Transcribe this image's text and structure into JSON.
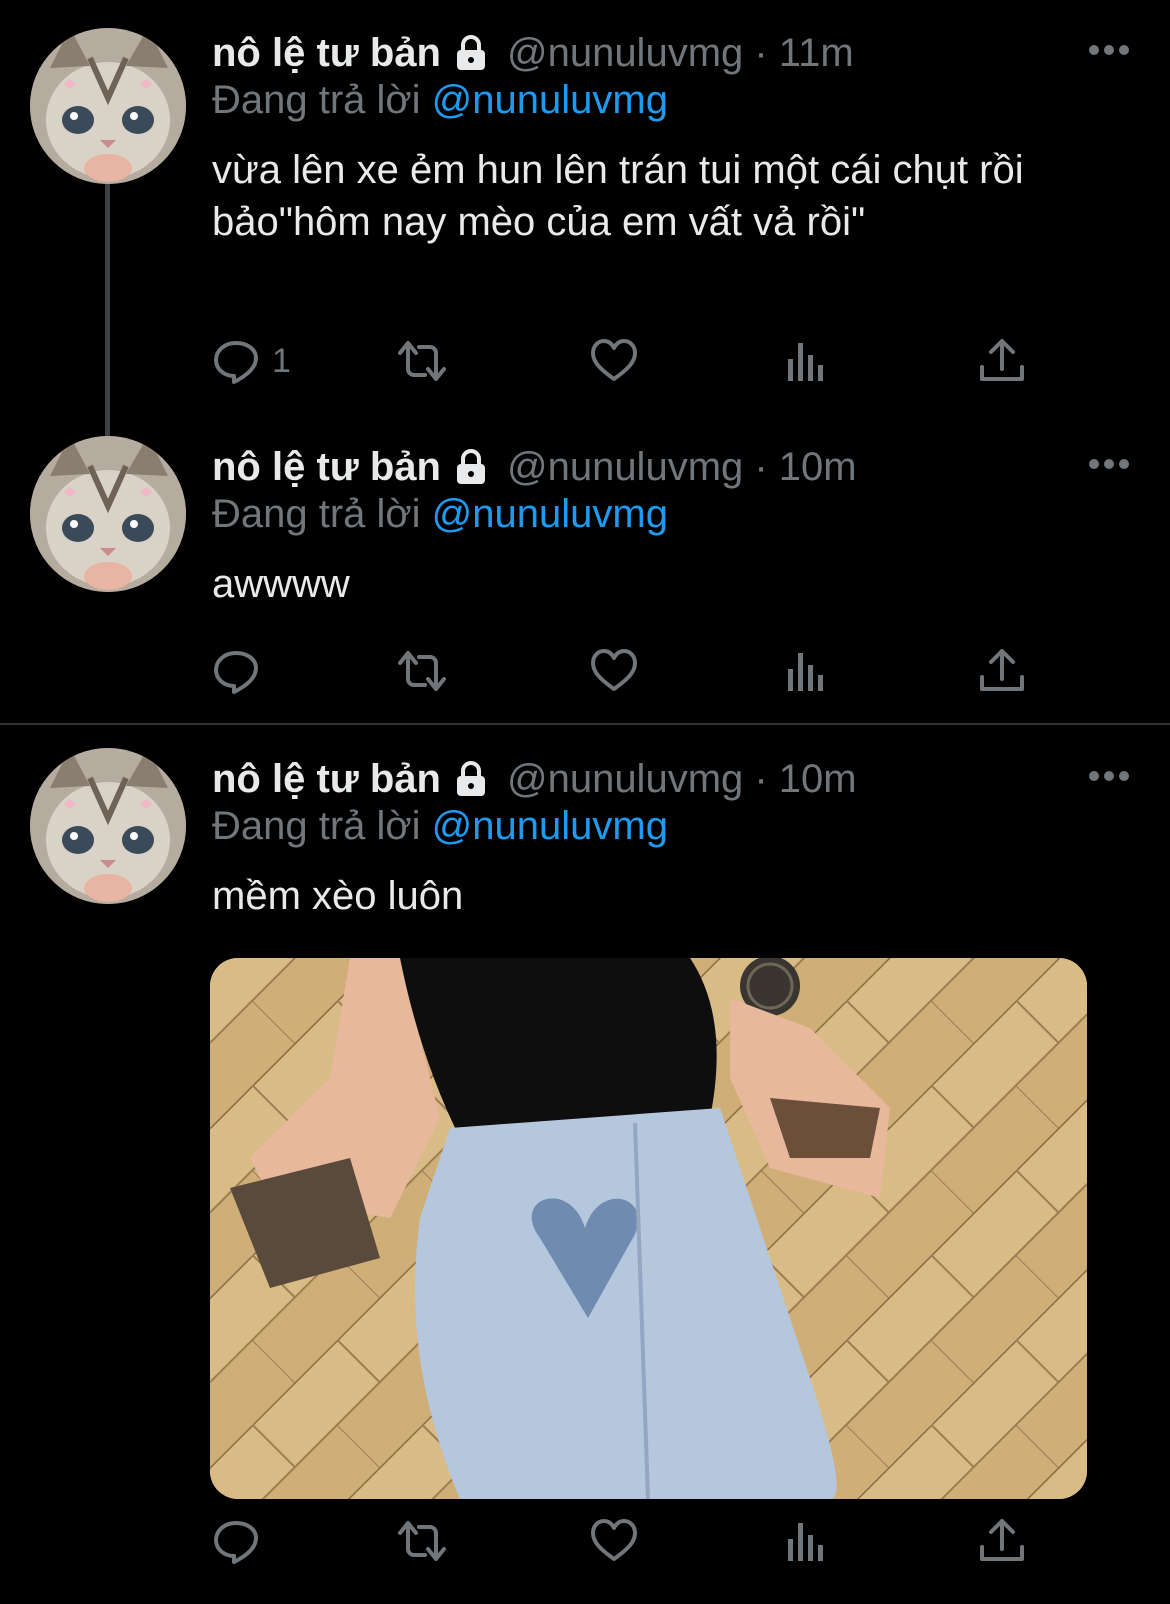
{
  "tweets": [
    {
      "name": "nô lệ tư bản",
      "handle_time": "@nunuluvmg · 11m",
      "replying_prefix": "Đang trả lời",
      "replying_to": "@nunuluvmg",
      "text": "vừa lên xe ẻm hun lên trán tui một cái chụt rồi bảo\"hôm nay mèo của em vất vả rồi\"",
      "reply_count": "1"
    },
    {
      "name": "nô lệ tư bản",
      "handle_time": "@nunuluvmg · 10m",
      "replying_prefix": "Đang trả lời",
      "replying_to": "@nunuluvmg",
      "text": "awwww",
      "reply_count": ""
    },
    {
      "name": "nô lệ tư bản",
      "handle_time": "@nunuluvmg · 10m",
      "replying_prefix": "Đang trả lời",
      "replying_to": "@nunuluvmg",
      "text": "mềm xèo luôn",
      "reply_count": ""
    }
  ],
  "icons": [
    "lock-icon",
    "more-icon",
    "reply-icon",
    "retweet-icon",
    "like-icon",
    "views-icon",
    "share-icon"
  ],
  "colors": {
    "background": "#000000",
    "text": "#e7e9ea",
    "secondary": "#71767b",
    "accent": "#1d9bf0",
    "divider": "#2f3336"
  }
}
